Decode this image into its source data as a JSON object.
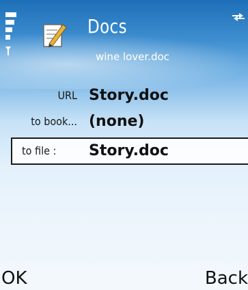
{
  "header": {
    "title": "Docs",
    "subtitle": "wine lover.doc",
    "signal_icon": "signal-strength-icon",
    "app_icon": "notepad-pen-icon",
    "status_icon": "data-connection-icon"
  },
  "form": {
    "url": {
      "label": "URL",
      "value": "Story.doc"
    },
    "to_bookmark": {
      "label": "to book...",
      "value": "(none)"
    },
    "to_file": {
      "label": "to file :",
      "value": "Story.doc"
    }
  },
  "softkeys": {
    "left": "OK",
    "right": "Back"
  },
  "colors": {
    "header_top": "#1d6fb8",
    "background_bottom": "#f3f8fc",
    "text": "#111111",
    "header_text": "#ffffff"
  }
}
